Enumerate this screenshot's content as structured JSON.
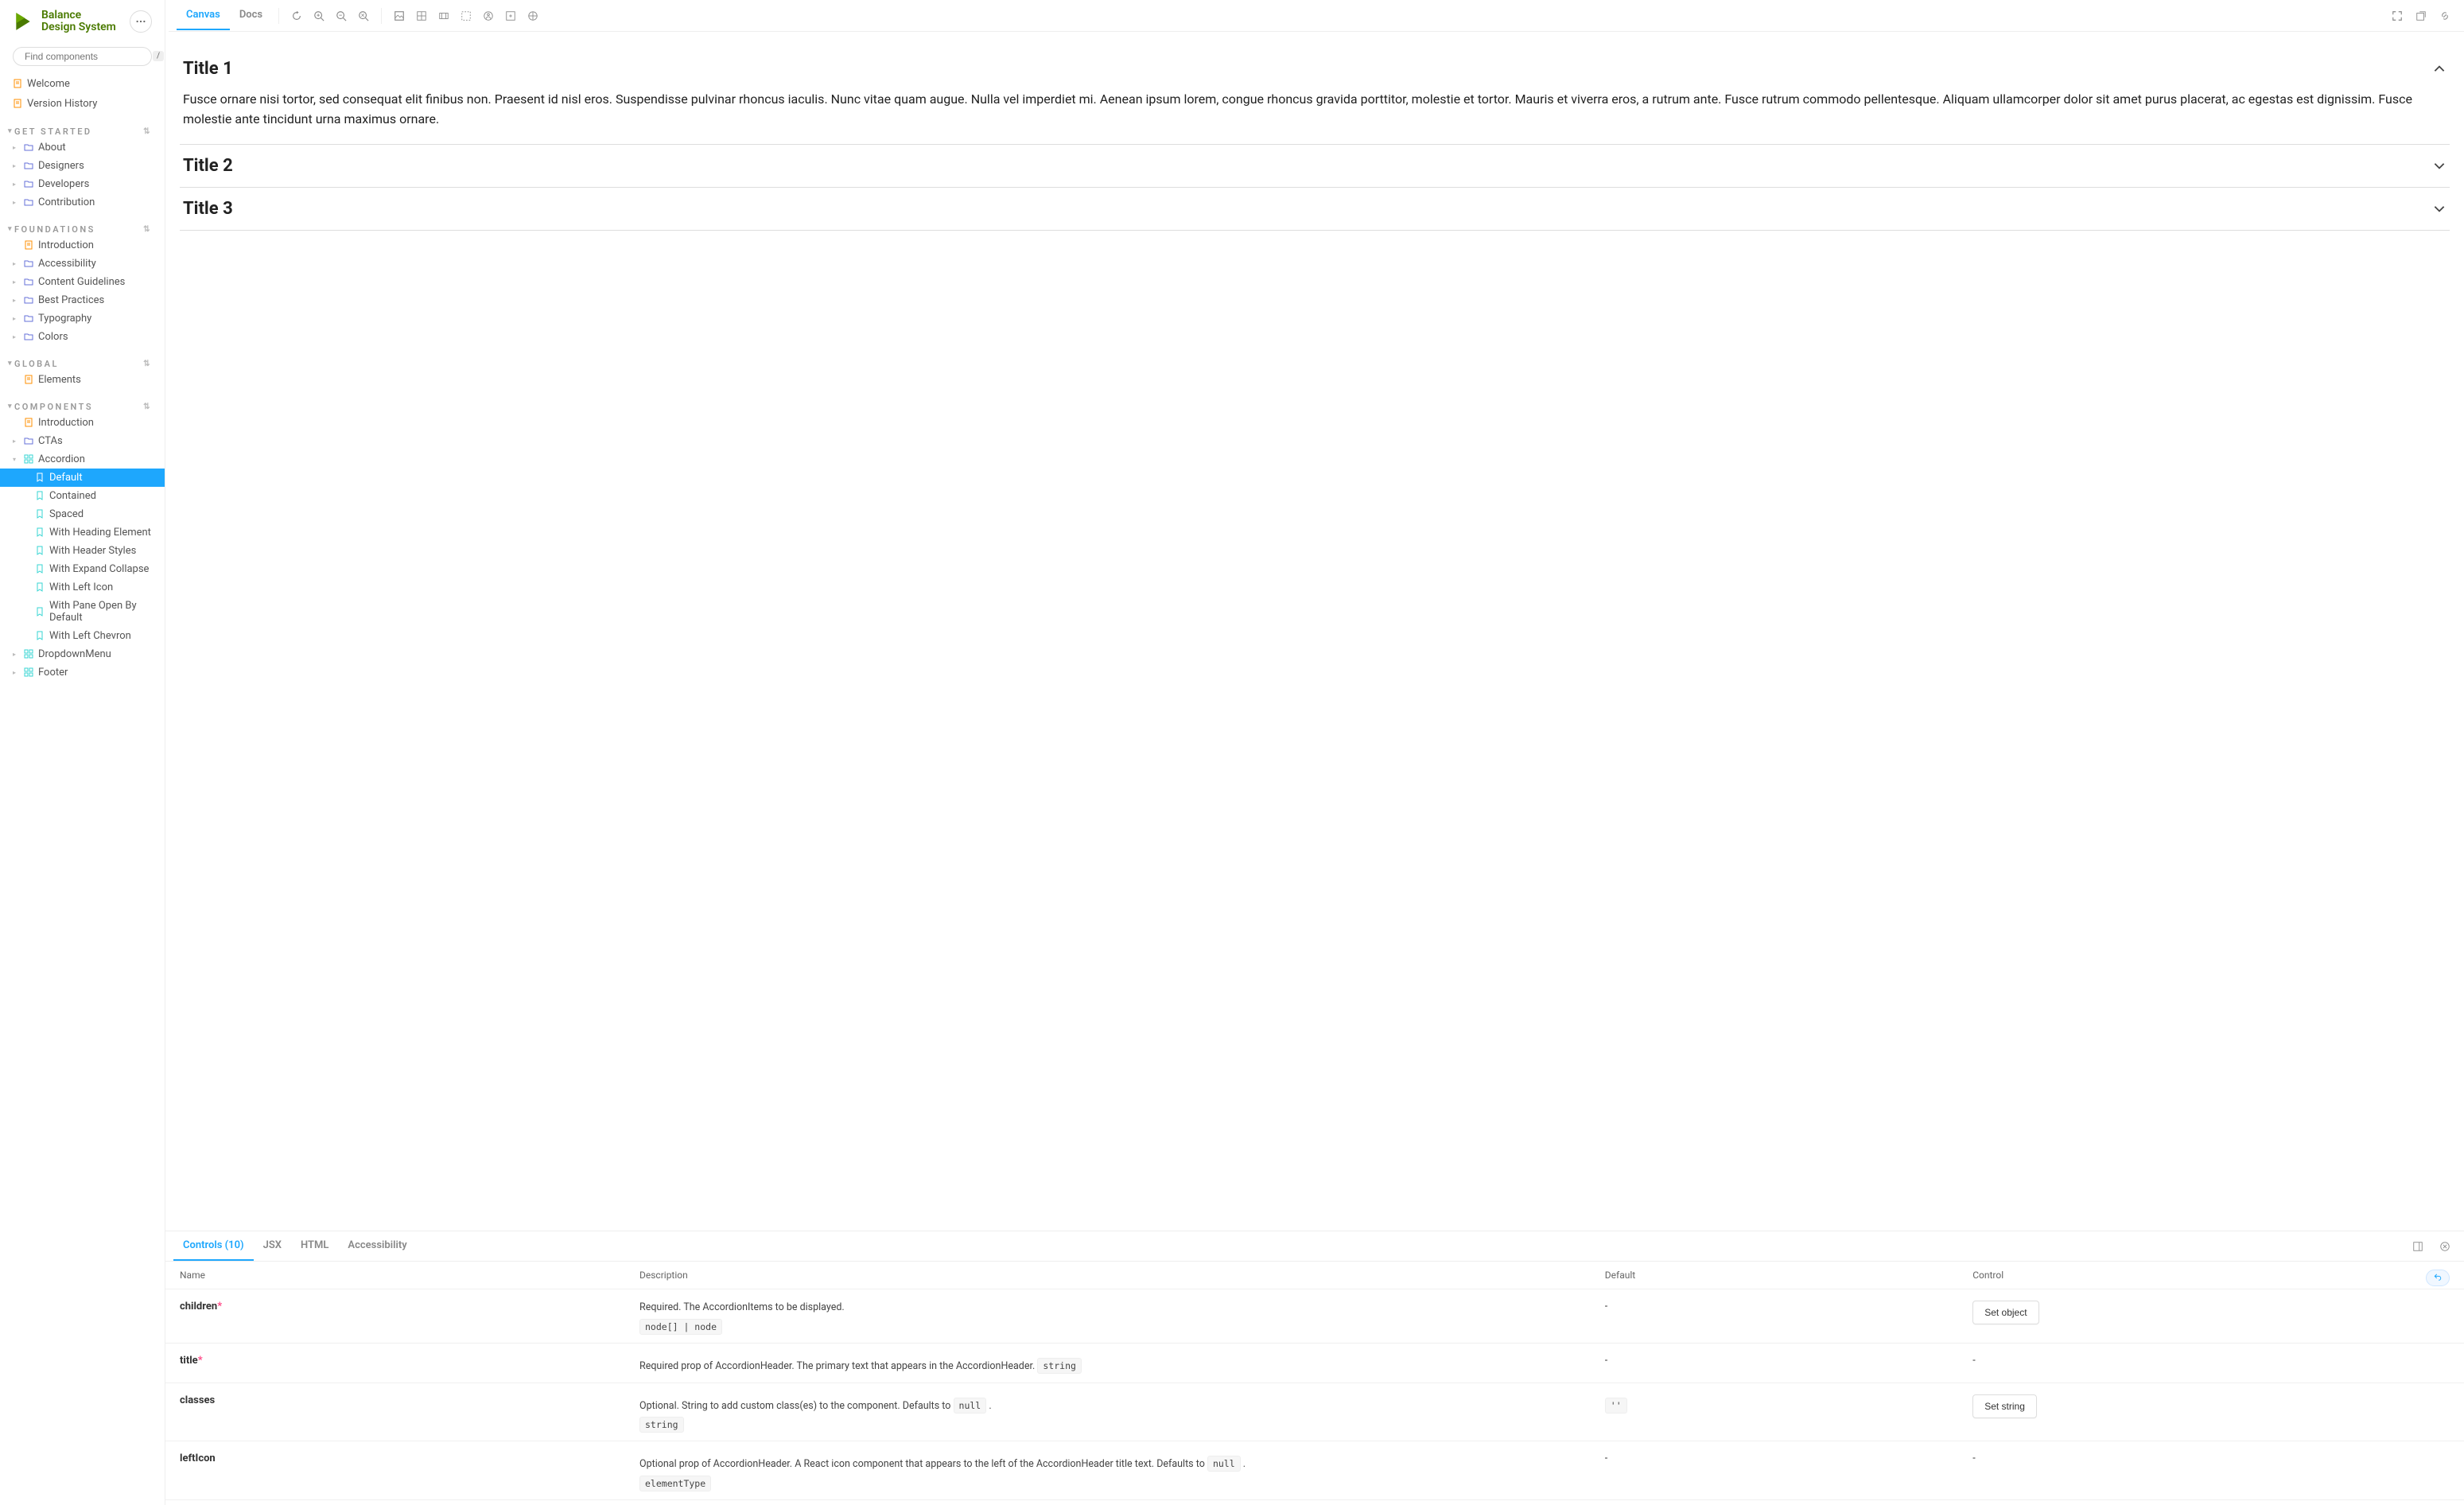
{
  "brand": {
    "line1": "Balance",
    "line2": "Design System"
  },
  "search": {
    "placeholder": "Find components",
    "shortcut": "/"
  },
  "nav": {
    "top": [
      {
        "label": "Welcome",
        "icon": "doc"
      },
      {
        "label": "Version History",
        "icon": "doc"
      }
    ],
    "sections": [
      {
        "title": "GET STARTED",
        "items": [
          {
            "label": "About",
            "icon": "folder",
            "caret": true
          },
          {
            "label": "Designers",
            "icon": "folder",
            "caret": true
          },
          {
            "label": "Developers",
            "icon": "folder",
            "caret": true
          },
          {
            "label": "Contribution",
            "icon": "folder",
            "caret": true
          }
        ]
      },
      {
        "title": "FOUNDATIONS",
        "items": [
          {
            "label": "Introduction",
            "icon": "doc",
            "caret": false
          },
          {
            "label": "Accessibility",
            "icon": "folder",
            "caret": true
          },
          {
            "label": "Content Guidelines",
            "icon": "folder",
            "caret": true
          },
          {
            "label": "Best Practices",
            "icon": "folder",
            "caret": true
          },
          {
            "label": "Typography",
            "icon": "folder",
            "caret": true
          },
          {
            "label": "Colors",
            "icon": "folder",
            "caret": true
          }
        ]
      },
      {
        "title": "GLOBAL",
        "items": [
          {
            "label": "Elements",
            "icon": "doc",
            "caret": false
          }
        ]
      },
      {
        "title": "COMPONENTS",
        "items": [
          {
            "label": "Introduction",
            "icon": "doc",
            "caret": false
          },
          {
            "label": "CTAs",
            "icon": "folder",
            "caret": true
          },
          {
            "label": "Accordion",
            "icon": "component",
            "caret": true,
            "expanded": true,
            "children": [
              {
                "label": "Default",
                "active": true
              },
              {
                "label": "Contained"
              },
              {
                "label": "Spaced"
              },
              {
                "label": "With Heading Element"
              },
              {
                "label": "With Header Styles"
              },
              {
                "label": "With Expand Collapse"
              },
              {
                "label": "With Left Icon"
              },
              {
                "label": "With Pane Open By Default"
              },
              {
                "label": "With Left Chevron"
              }
            ]
          },
          {
            "label": "DropdownMenu",
            "icon": "component",
            "caret": true
          },
          {
            "label": "Footer",
            "icon": "component",
            "caret": true
          }
        ]
      }
    ]
  },
  "toolbar": {
    "tabs": [
      {
        "label": "Canvas",
        "active": true
      },
      {
        "label": "Docs",
        "active": false
      }
    ]
  },
  "canvas": {
    "accordion": [
      {
        "title": "Title 1",
        "open": true,
        "body": "Fusce ornare nisi tortor, sed consequat elit finibus non. Praesent id nisl eros. Suspendisse pulvinar rhoncus iaculis. Nunc vitae quam augue. Nulla vel imperdiet mi. Aenean ipsum lorem, congue rhoncus gravida porttitor, molestie et tortor. Mauris et viverra eros, a rutrum ante. Fusce rutrum commodo pellentesque. Aliquam ullamcorper dolor sit amet purus placerat, ac egestas est dignissim. Fusce molestie ante tincidunt urna maximus ornare."
      },
      {
        "title": "Title 2",
        "open": false
      },
      {
        "title": "Title 3",
        "open": false
      }
    ]
  },
  "addon": {
    "tabs": [
      {
        "label": "Controls (10)",
        "active": true
      },
      {
        "label": "JSX"
      },
      {
        "label": "HTML"
      },
      {
        "label": "Accessibility"
      }
    ],
    "columns": {
      "name": "Name",
      "description": "Description",
      "default": "Default",
      "control": "Control"
    },
    "rows": [
      {
        "name": "children",
        "required": true,
        "description": "Required. The AccordionItems to be displayed.",
        "type": "node[] | node",
        "default": "-",
        "control": {
          "kind": "button",
          "label": "Set object"
        }
      },
      {
        "name": "title",
        "required": true,
        "description": "Required prop of AccordionHeader. The primary text that appears in the AccordionHeader.",
        "type_inline": "string",
        "default": "-",
        "control": {
          "kind": "dash"
        }
      },
      {
        "name": "classes",
        "required": false,
        "description": "Optional. String to add custom class(es) to the component. Defaults to",
        "type_inline_first": "null",
        "description_after": ".",
        "type": "string",
        "default_code": "''",
        "control": {
          "kind": "button",
          "label": "Set string"
        }
      },
      {
        "name": "leftIcon",
        "required": false,
        "description": "Optional prop of AccordionHeader. A React icon component that appears to the left of the AccordionHeader title text. Defaults to",
        "type_inline_first": "null",
        "description_after": ".",
        "type": "elementType",
        "default": "-",
        "control": {
          "kind": "dash"
        }
      }
    ]
  }
}
